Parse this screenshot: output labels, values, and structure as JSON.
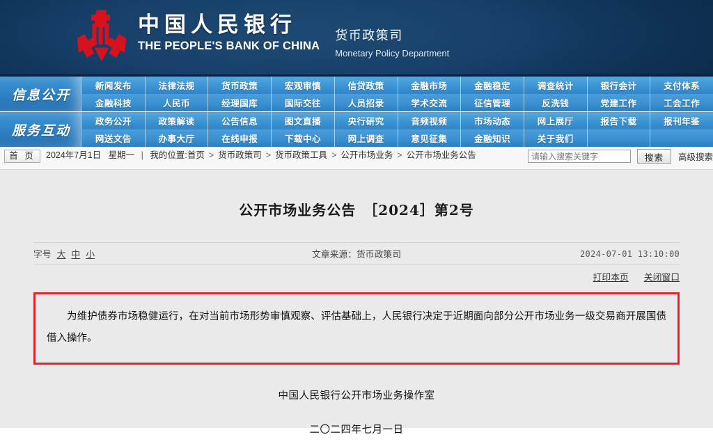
{
  "header": {
    "bank_cn": "中国人民银行",
    "bank_en": "THE PEOPLE'S BANK OF CHINA",
    "dept_cn": "货币政策司",
    "dept_en": "Monetary Policy Department",
    "logo_icon": "pboc-logo-icon"
  },
  "nav": {
    "groups": [
      {
        "title": "信息公开",
        "rows": [
          [
            "新闻发布",
            "法律法规",
            "货币政策",
            "宏观审慎",
            "信贷政策",
            "金融市场",
            "金融稳定",
            "调查统计",
            "银行会计",
            "支付体系"
          ],
          [
            "金融科技",
            "人民币",
            "经理国库",
            "国际交往",
            "人员招录",
            "学术交流",
            "征信管理",
            "反洗钱",
            "党建工作",
            "工会工作"
          ]
        ]
      },
      {
        "title": "服务互动",
        "rows": [
          [
            "政务公开",
            "政策解读",
            "公告信息",
            "图文直播",
            "央行研究",
            "音频视频",
            "市场动态",
            "网上展厅",
            "报告下载",
            "报刊年鉴"
          ],
          [
            "网送文告",
            "办事大厅",
            "在线申报",
            "下载中心",
            "网上调查",
            "意见征集",
            "金融知识",
            "关于我们",
            "",
            ""
          ]
        ]
      }
    ]
  },
  "crumb": {
    "home_label": "首 页",
    "date": "2024年7月1日",
    "weekday": "星期一",
    "divider": "|",
    "location_label": "我的位置:",
    "path": [
      "首页",
      "货币政策司",
      "货币政策工具",
      "公开市场业务",
      "公开市场业务公告"
    ],
    "separator": ">"
  },
  "search": {
    "placeholder": "请输入搜索关键字",
    "value": "",
    "button_label": "搜索",
    "advanced_label": "高级搜索",
    "icon": "search-icon"
  },
  "article": {
    "title": "公开市场业务公告　［2024］第2号",
    "fontsize_label": "字号",
    "fontsize_options": [
      "大",
      "中",
      "小"
    ],
    "source": "文章来源：货币政策司",
    "timestamp": "2024-07-01 13:10:00",
    "print_label": "打印本页",
    "close_label": "关闭窗口",
    "body": "为维护债券市场稳健运行，在对当前市场形势审慎观察、评估基础上，人民银行决定于近期面向部分公开市场业务一级交易商开展国债借入操作。",
    "signature": "中国人民银行公开市场业务操作室",
    "sign_date": "二〇二四年七月一日"
  },
  "colors": {
    "banner_dark_blue": "#0d2f50",
    "nav_blue": "#3d94d3",
    "accent_red": "#e8202a",
    "logo_red": "#d8121c",
    "content_bg": "#eaeaea"
  }
}
